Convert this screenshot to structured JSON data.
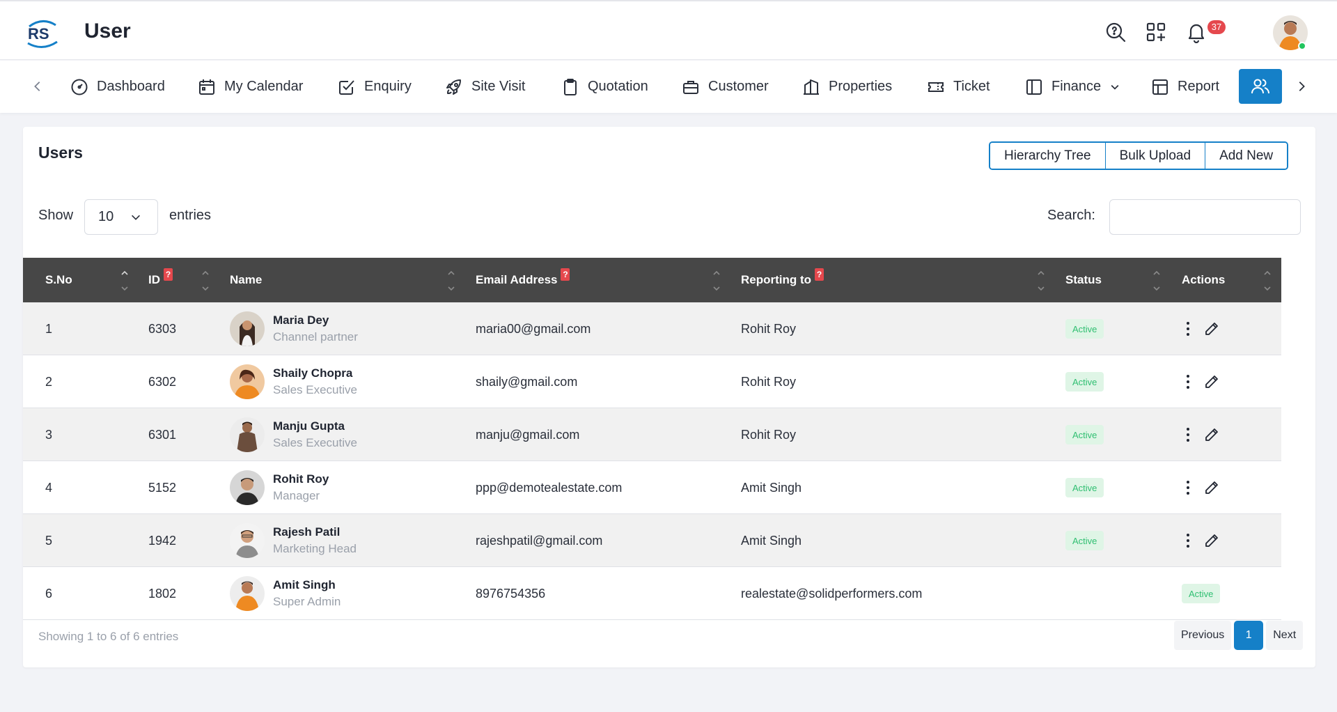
{
  "app": {
    "page_title": "User",
    "notification_count": "37"
  },
  "nav": [
    {
      "label": "Dashboard",
      "icon": "dashboard-icon"
    },
    {
      "label": "My Calendar",
      "icon": "calendar-icon"
    },
    {
      "label": "Enquiry",
      "icon": "enquiry-icon"
    },
    {
      "label": "Site Visit",
      "icon": "rocket-icon"
    },
    {
      "label": "Quotation",
      "icon": "clipboard-icon"
    },
    {
      "label": "Customer",
      "icon": "briefcase-icon"
    },
    {
      "label": "Properties",
      "icon": "properties-icon"
    },
    {
      "label": "Ticket",
      "icon": "ticket-icon"
    },
    {
      "label": "Finance",
      "icon": "finance-icon"
    },
    {
      "label": "Report",
      "icon": "report-icon"
    }
  ],
  "card": {
    "title": "Users",
    "buttons": {
      "hierarchy": "Hierarchy Tree",
      "bulk": "Bulk Upload",
      "add": "Add New"
    },
    "show_label": "Show",
    "entries_value": "10",
    "entries_label": "entries",
    "search_label": "Search:"
  },
  "table": {
    "headers": {
      "sno": "S.No",
      "id": "ID",
      "name": "Name",
      "email": "Email Address",
      "reporting": "Reporting to",
      "status": "Status",
      "actions": "Actions",
      "help_mark": "?"
    },
    "rows": [
      {
        "sno": "1",
        "id": "6303",
        "name": "Maria Dey",
        "role": "Channel partner",
        "email": "maria00@gmail.com",
        "reporting": "Rohit Roy",
        "status": "Active"
      },
      {
        "sno": "2",
        "id": "6302",
        "name": "Shaily Chopra",
        "role": "Sales Executive",
        "email": "shaily@gmail.com",
        "reporting": "Rohit Roy",
        "status": "Active"
      },
      {
        "sno": "3",
        "id": "6301",
        "name": "Manju Gupta",
        "role": "Sales Executive",
        "email": "manju@gmail.com",
        "reporting": "Rohit Roy",
        "status": "Active"
      },
      {
        "sno": "4",
        "id": "5152",
        "name": "Rohit Roy",
        "role": "Manager",
        "email": "ppp@demotealestate.com",
        "reporting": "Amit Singh",
        "status": "Active"
      },
      {
        "sno": "5",
        "id": "1942",
        "name": "Rajesh Patil",
        "role": "Marketing Head",
        "email": "rajeshpatil@gmail.com",
        "reporting": "Amit Singh",
        "status": "Active"
      },
      {
        "sno": "6",
        "id": "1802",
        "name": "Amit Singh",
        "role": "Super Admin",
        "email": "8976754356",
        "reporting": "realestate@solidperformers.com",
        "status": "Active"
      }
    ]
  },
  "footer": {
    "info": "Showing 1 to 6 of 6 entries",
    "previous": "Previous",
    "current_page": "1",
    "next": "Next"
  },
  "colors": {
    "accent": "#1580c8",
    "header_dark": "#474747",
    "badge_red": "#e5484d",
    "status_green": "#2fbf71"
  }
}
